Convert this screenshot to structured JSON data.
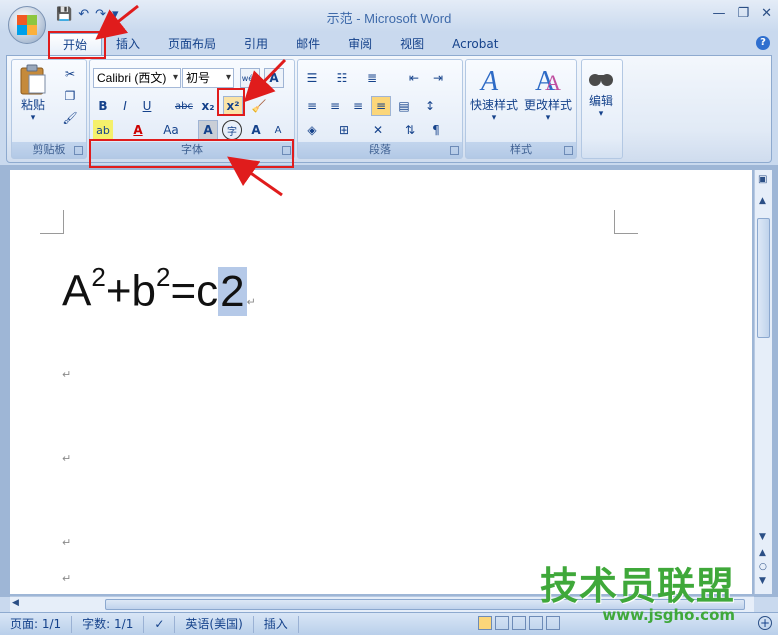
{
  "window": {
    "title": "示范 - Microsoft Word",
    "qat": {
      "save": "💾",
      "undo": "↶",
      "redo": "↷",
      "more": "▾"
    },
    "controls": {
      "minimize": "—",
      "restore": "❐",
      "close": "✕"
    }
  },
  "tabs": [
    {
      "label": "开始",
      "active": true
    },
    {
      "label": "插入"
    },
    {
      "label": "页面布局"
    },
    {
      "label": "引用"
    },
    {
      "label": "邮件"
    },
    {
      "label": "审阅"
    },
    {
      "label": "视图"
    },
    {
      "label": "Acrobat"
    }
  ],
  "help": "?",
  "ribbon": {
    "clipboard": {
      "label": "剪贴板",
      "paste": "粘贴"
    },
    "font": {
      "label": "字体",
      "font_name": "Calibri (西文)",
      "font_size": "初号",
      "bold": "B",
      "italic": "I",
      "underline": "U",
      "strike": "abc",
      "subscript": "x₂",
      "superscript": "x²",
      "highlight": "ab",
      "font_color": "A",
      "change_case": "Aa",
      "char_shading": "A",
      "enclose": "字",
      "grow": "A",
      "shrink": "A"
    },
    "paragraph": {
      "label": "段落"
    },
    "styles": {
      "label": "样式",
      "quick": "快速样式",
      "change": "更改样式"
    },
    "editing": {
      "label": "编辑"
    }
  },
  "document": {
    "eq_A": "A",
    "eq_sup1": "2",
    "eq_plus": "+b",
    "eq_sup2": "2",
    "eq_eq": "=c",
    "eq_selected": "2",
    "para_mark": "↵"
  },
  "status": {
    "page": "页面: 1/1",
    "words": "字数: 1/1",
    "language": "英语(美国)",
    "mode": "插入"
  },
  "watermark": {
    "title": "技术员联盟",
    "url": "www.jsgho.com"
  },
  "colors": {
    "annotation_red": "#e01c1c",
    "ribbon_text": "#15428b",
    "watermark_green": "#3fa83a"
  }
}
